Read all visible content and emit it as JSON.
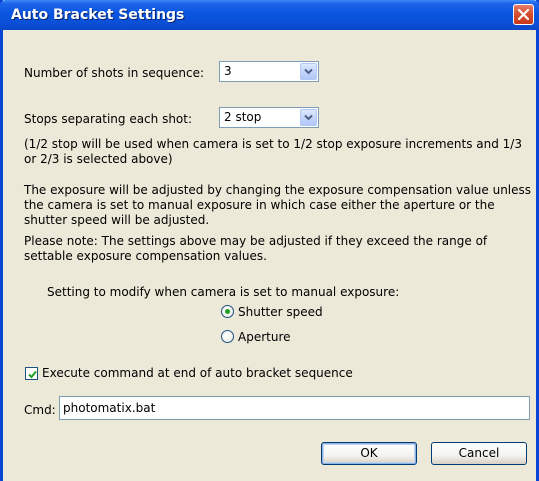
{
  "window": {
    "title": "Auto Bracket Settings"
  },
  "shots": {
    "label": "Number of shots in sequence:",
    "value": "3"
  },
  "stops": {
    "label": "Stops separating each shot:",
    "value": "2 stop"
  },
  "note_half_stop": "(1/2 stop will be used when camera is set to 1/2 stop exposure increments and 1/3 or 2/3 is selected above)",
  "note_exposure": "The exposure will be adjusted by changing the exposure compensation value unless the camera is set to manual exposure in which case either the aperture or the shutter speed will be adjusted.",
  "note_please": "Please note: The settings above may be adjusted if they exceed the range of settable exposure compensation values.",
  "manual": {
    "label": "Setting to modify when camera is set to manual exposure:",
    "options": [
      {
        "label": "Shutter speed",
        "selected": true
      },
      {
        "label": "Aperture",
        "selected": false
      }
    ]
  },
  "execute": {
    "label": "Execute command at end of auto bracket sequence",
    "checked": true
  },
  "cmd": {
    "label": "Cmd:",
    "value": "photomatix.bat"
  },
  "buttons": {
    "ok": "OK",
    "cancel": "Cancel"
  },
  "colors": {
    "titlebar": "#0a55e0",
    "dialog_bg": "#ece9d8",
    "radio_dot": "#21a121",
    "checkmark": "#21a121"
  }
}
